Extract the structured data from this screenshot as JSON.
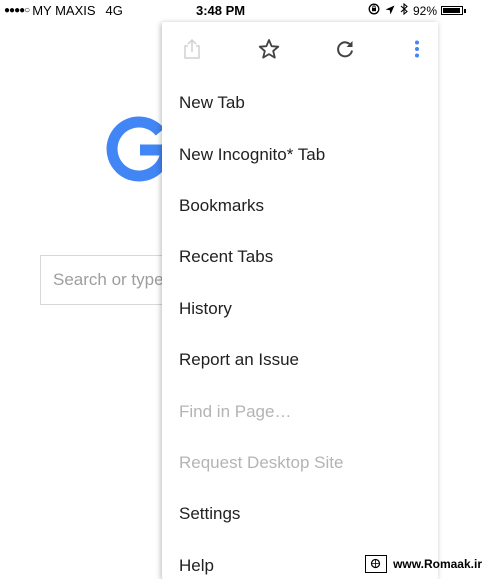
{
  "status_bar": {
    "signal": "●●●●○",
    "carrier": "MY MAXIS",
    "network": "4G",
    "time": "3:48 PM",
    "battery": "92%",
    "battery_level": 0.92
  },
  "page": {
    "search_placeholder": "Search or type",
    "logo_color": "#4285F4"
  },
  "menu": {
    "toolbar": {
      "share_icon": "share-icon",
      "bookmark_icon": "star-icon",
      "reload_icon": "reload-icon",
      "more_icon": "more-vert-icon"
    },
    "items": [
      {
        "label": "New Tab",
        "enabled": true
      },
      {
        "label": "New Incognito* Tab",
        "enabled": true
      },
      {
        "label": "Bookmarks",
        "enabled": true
      },
      {
        "label": "Recent Tabs",
        "enabled": true
      },
      {
        "label": "History",
        "enabled": true
      },
      {
        "label": "Report an Issue",
        "enabled": true
      },
      {
        "label": "Find in Page…",
        "enabled": false
      },
      {
        "label": "Request Desktop Site",
        "enabled": false
      },
      {
        "label": "Settings",
        "enabled": true
      },
      {
        "label": "Help",
        "enabled": true
      }
    ]
  },
  "watermark": {
    "text": "www.Romaak.ir"
  },
  "colors": {
    "accent": "#4285F4",
    "disabled_text": "#B4B4B4",
    "text": "#212121"
  }
}
